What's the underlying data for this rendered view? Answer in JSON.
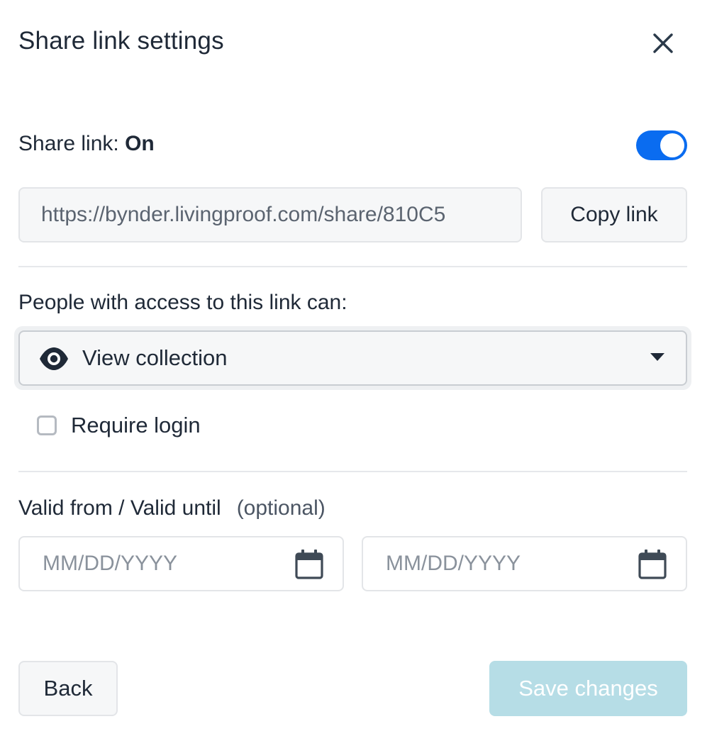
{
  "dialog": {
    "title": "Share link settings",
    "close_icon": "close-icon"
  },
  "share_link": {
    "label": "Share link:",
    "state": "On",
    "enabled": true,
    "accent_color": "#0a6cf0"
  },
  "url": {
    "value": "https://bynder.livingproof.com/share/810C5",
    "copy_label": "Copy link"
  },
  "permissions": {
    "label": "People with access to this link can:",
    "selected": "View collection",
    "icon": "eye-icon"
  },
  "require_login": {
    "label": "Require login",
    "checked": false
  },
  "validity": {
    "label": "Valid from / Valid until",
    "optional": "(optional)",
    "from_placeholder": "MM/DD/YYYY",
    "until_placeholder": "MM/DD/YYYY",
    "icon": "calendar-icon"
  },
  "footer": {
    "back_label": "Back",
    "save_label": "Save changes",
    "save_disabled": true,
    "save_color": "#b6dde6"
  }
}
